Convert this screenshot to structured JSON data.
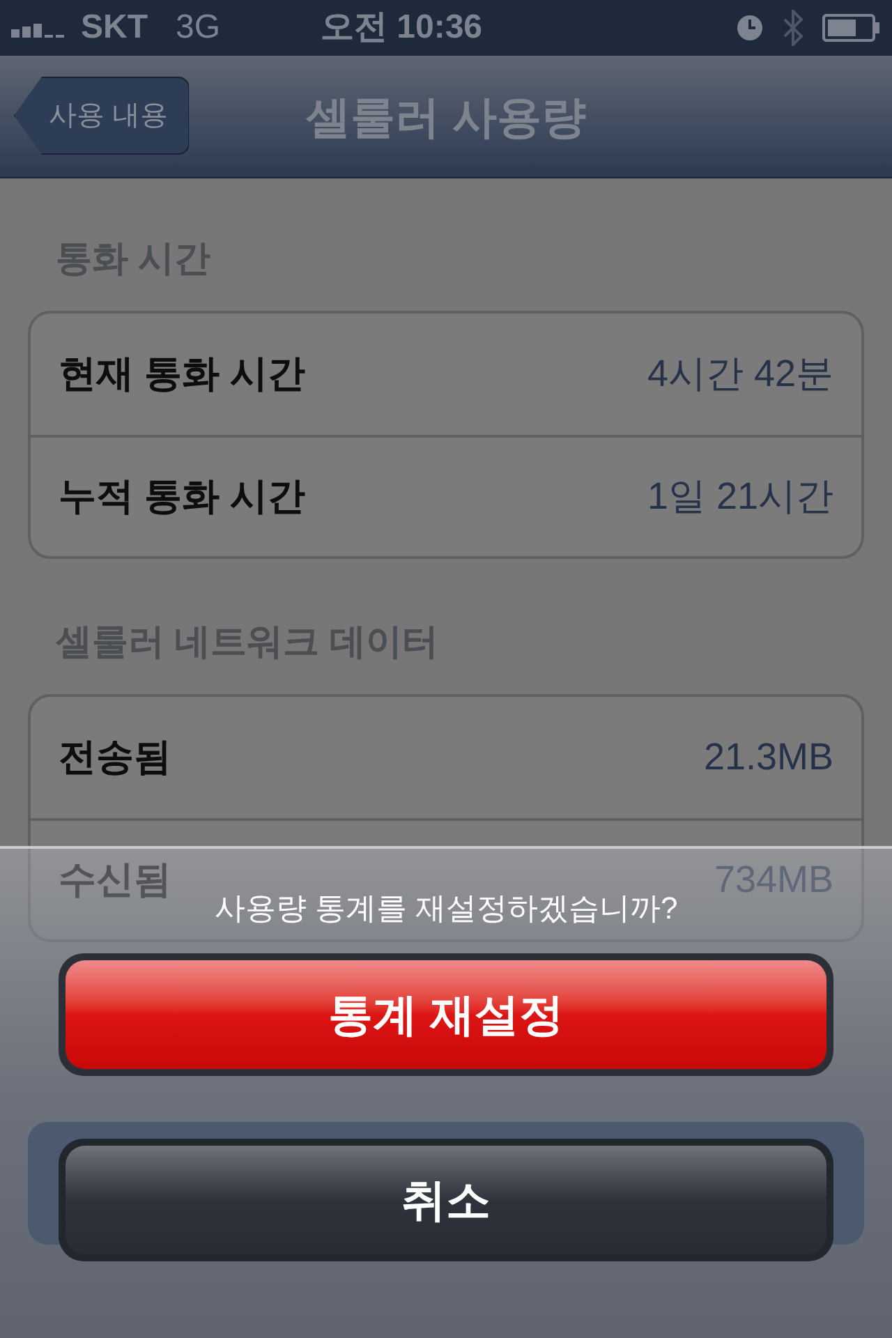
{
  "status_bar": {
    "carrier": "SKT",
    "network": "3G",
    "time": "오전 10:36"
  },
  "nav_bar": {
    "back_button": "사용 내용",
    "title": "셀룰러 사용량"
  },
  "sections": [
    {
      "header": "통화 시간",
      "rows": [
        {
          "label": "현재 통화 시간",
          "value": "4시간 42분"
        },
        {
          "label": "누적 통화 시간",
          "value": "1일 21시간"
        }
      ]
    },
    {
      "header": "셀룰러 네트워크 데이터",
      "rows": [
        {
          "label": "전송됨",
          "value": "21.3MB"
        },
        {
          "label": "수신됨",
          "value": "734MB"
        }
      ]
    }
  ],
  "action_sheet": {
    "message": "사용량 통계를 재설정하겠습니까?",
    "buttons": [
      {
        "label": "통계 재설정",
        "kind": "destructive"
      },
      {
        "label": "취소",
        "kind": "cancel"
      }
    ]
  }
}
